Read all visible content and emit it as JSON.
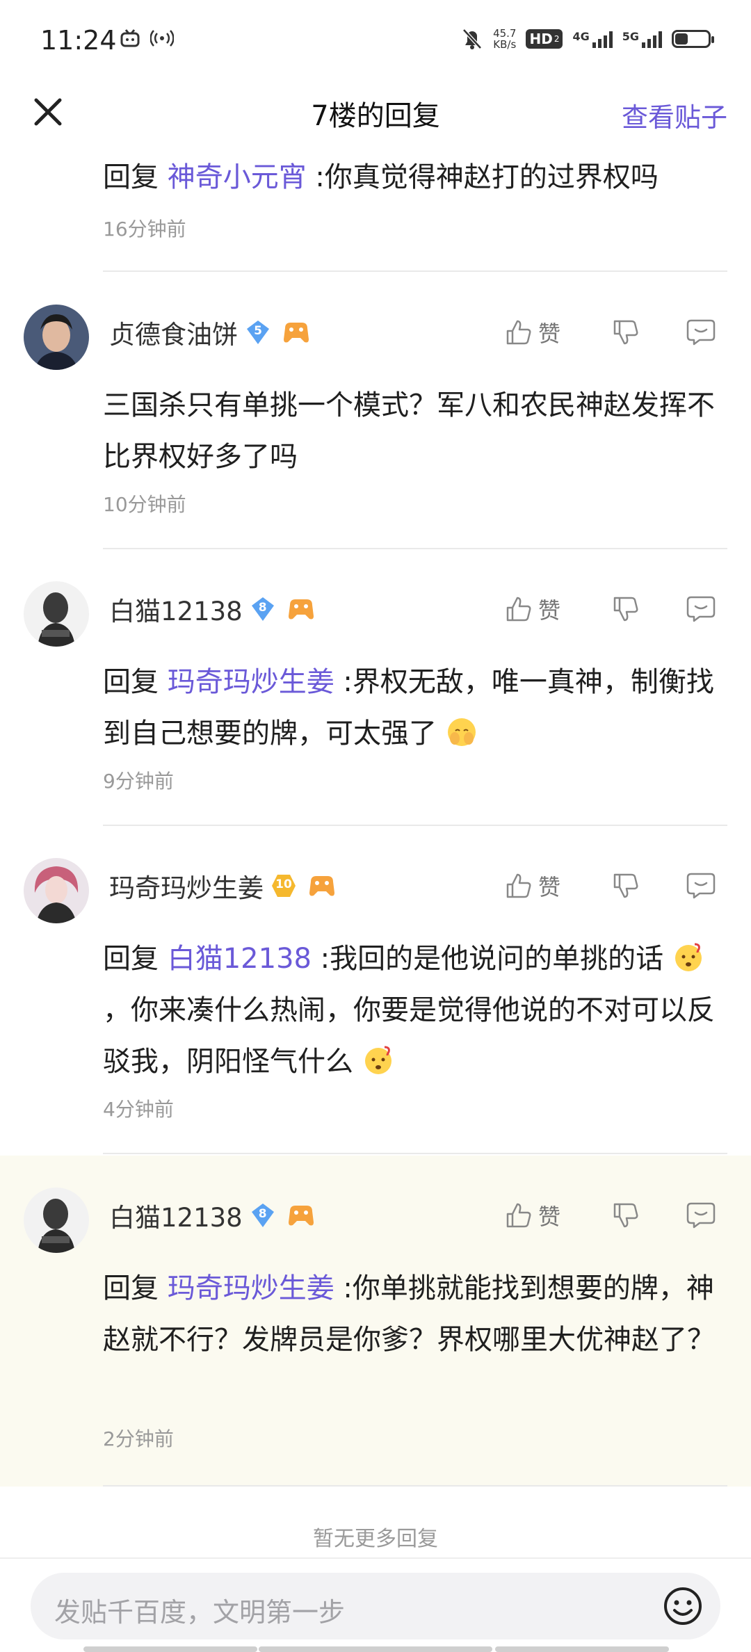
{
  "status_bar": {
    "time": "11:24",
    "net_speed_value": "45.7",
    "net_speed_unit": "KB/s",
    "hd_label": "HD",
    "sim1": "4G",
    "sim2": "5G"
  },
  "header": {
    "title": "7楼的回复",
    "view_post": "查看贴子"
  },
  "replies": [
    {
      "reply_prefix": "回复",
      "mention": "神奇小元宵",
      "text": " :你真觉得神赵打的过界权吗",
      "time": "16分钟前"
    },
    {
      "username": "贞德食油饼",
      "level": "5",
      "like_label": "赞",
      "text": "三国杀只有单挑一个模式？军八和农民神赵发挥不比界权好多了吗",
      "time": "10分钟前"
    },
    {
      "username": "白猫12138",
      "level": "8",
      "like_label": "赞",
      "reply_prefix": "回复",
      "mention": "玛奇玛炒生姜",
      "text": " :界权无敌，唯一真神，制衡找到自己想要的牌，可太强了",
      "time": "9分钟前"
    },
    {
      "username": "玛奇玛炒生姜",
      "level": "10",
      "like_label": "赞",
      "reply_prefix": "回复",
      "mention": "白猫12138",
      "text_part1": " :我回的是他说问的单挑的话",
      "text_part2": "，你来凑什么热闹，你要是觉得他说的不对可以反驳我，阴阳怪气什么",
      "time": "4分钟前"
    },
    {
      "username": "白猫12138",
      "level": "8",
      "like_label": "赞",
      "reply_prefix": "回复",
      "mention": "玛奇玛炒生姜",
      "text": " :你单挑就能找到想要的牌，神赵就不行？发牌员是你爹？界权哪里大优神赵了？",
      "time": "2分钟前"
    }
  ],
  "no_more": "暂无更多回复",
  "composer": {
    "placeholder": "发贴千百度，文明第一步"
  },
  "colors": {
    "accent": "#6a59d8",
    "highlight_bg": "#fbfaf0",
    "badge_blue": "#5aa2f2",
    "badge_gold": "#f5b82e"
  },
  "icons": [
    "close-icon",
    "thumb-up-icon",
    "thumb-down-icon",
    "comment-icon",
    "game-controller-icon",
    "emoji-icon"
  ]
}
